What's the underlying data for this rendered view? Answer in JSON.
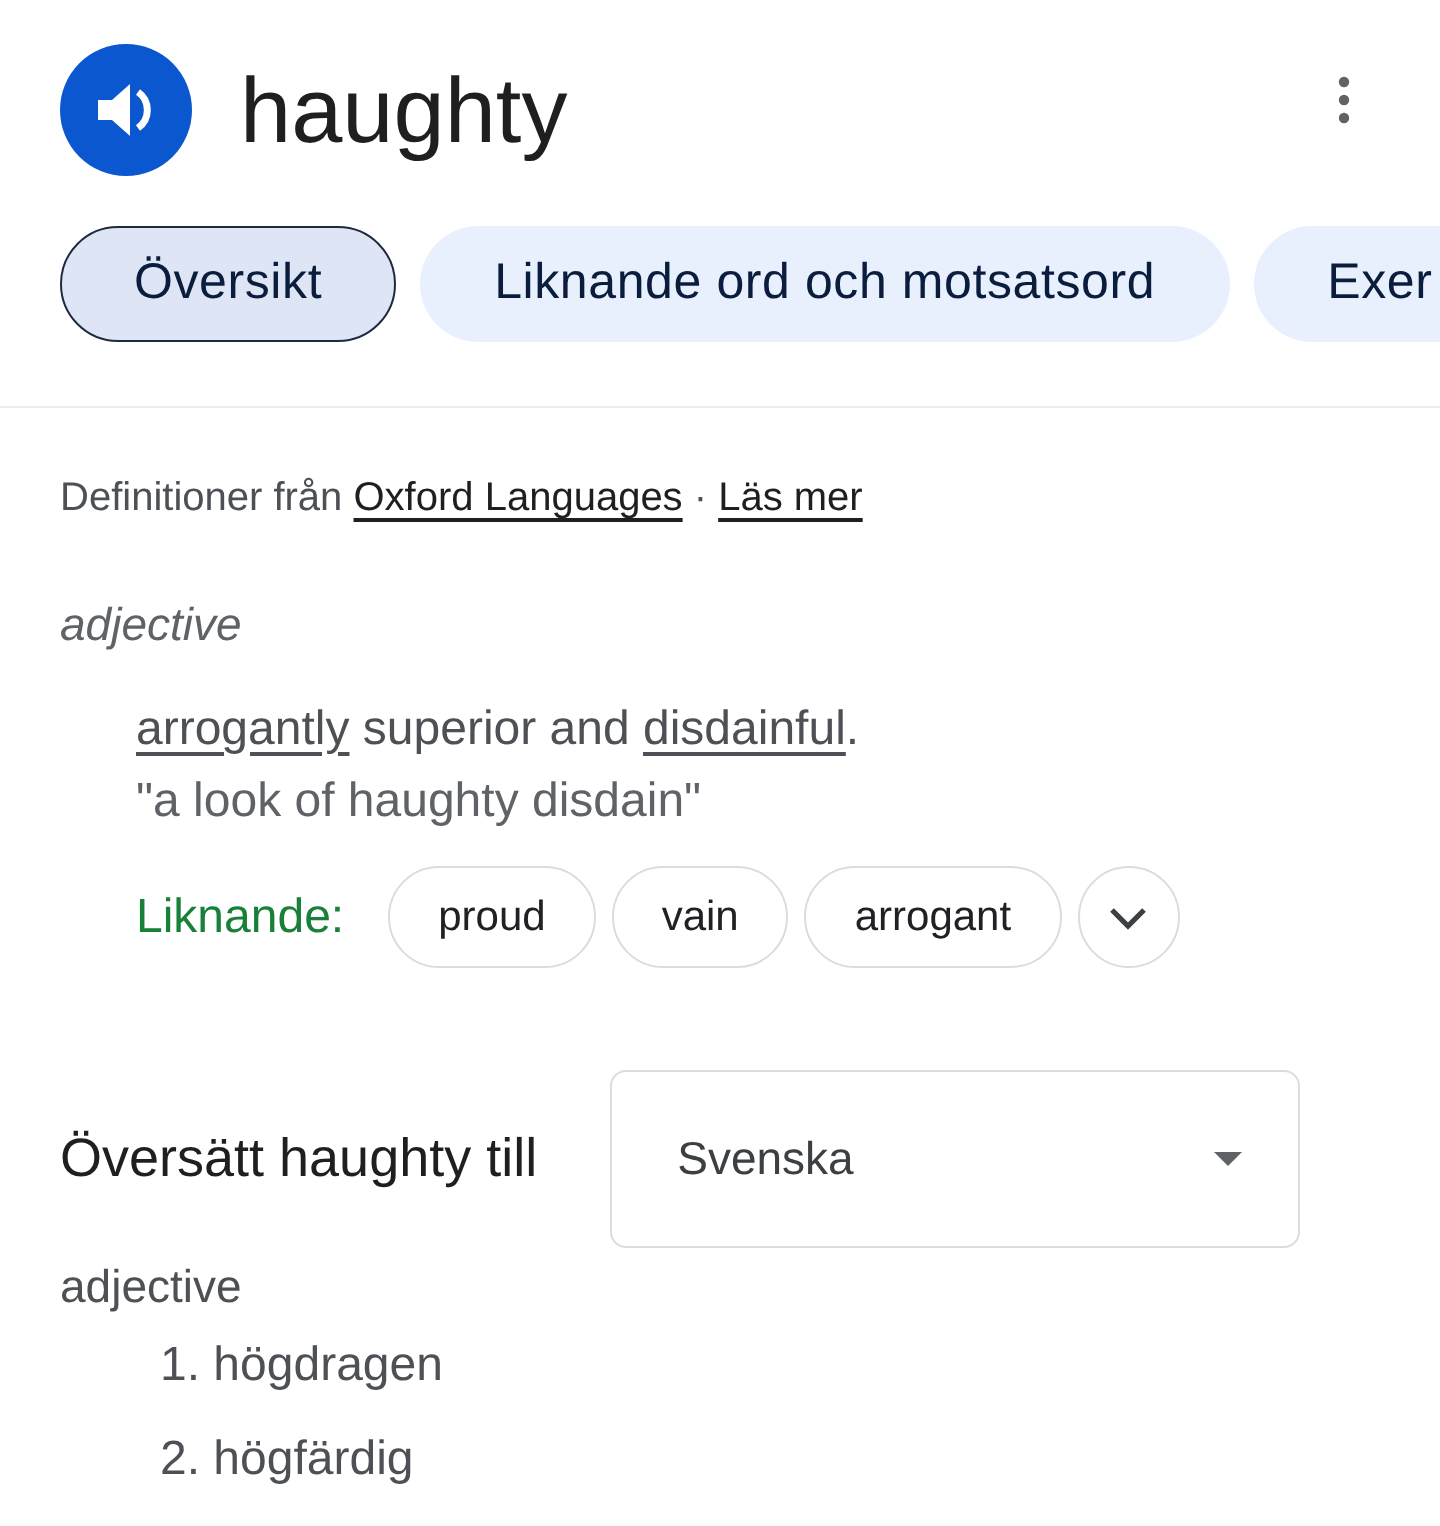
{
  "header": {
    "word": "haughty"
  },
  "tabs": [
    {
      "label": "Översikt",
      "selected": true
    },
    {
      "label": "Liknande ord och motsatsord",
      "selected": false
    },
    {
      "label": "Exer",
      "selected": false
    }
  ],
  "source": {
    "parts": [
      {
        "kind": "text",
        "text": "Definitioner från "
      },
      {
        "kind": "link",
        "text": "Oxford Languages"
      },
      {
        "kind": "text",
        "text": " · "
      },
      {
        "kind": "link",
        "text": "Läs mer"
      }
    ]
  },
  "entry": {
    "part_of_speech": "adjective",
    "definition": [
      {
        "kind": "link",
        "text": "arrogantly"
      },
      {
        "kind": "text",
        "text": " superior and "
      },
      {
        "kind": "link",
        "text": "disdainful"
      },
      {
        "kind": "text",
        "text": "."
      }
    ],
    "example": "\"a look of haughty disdain\"",
    "similar": {
      "label": "Liknande:",
      "words": [
        "proud",
        "vain",
        "arrogant"
      ],
      "expanded": false
    }
  },
  "translate": {
    "label": "Översätt haughty till",
    "language": "Svenska",
    "part_of_speech": "adjective",
    "translations": [
      "1. högdragen",
      "2. högfärdig"
    ]
  }
}
